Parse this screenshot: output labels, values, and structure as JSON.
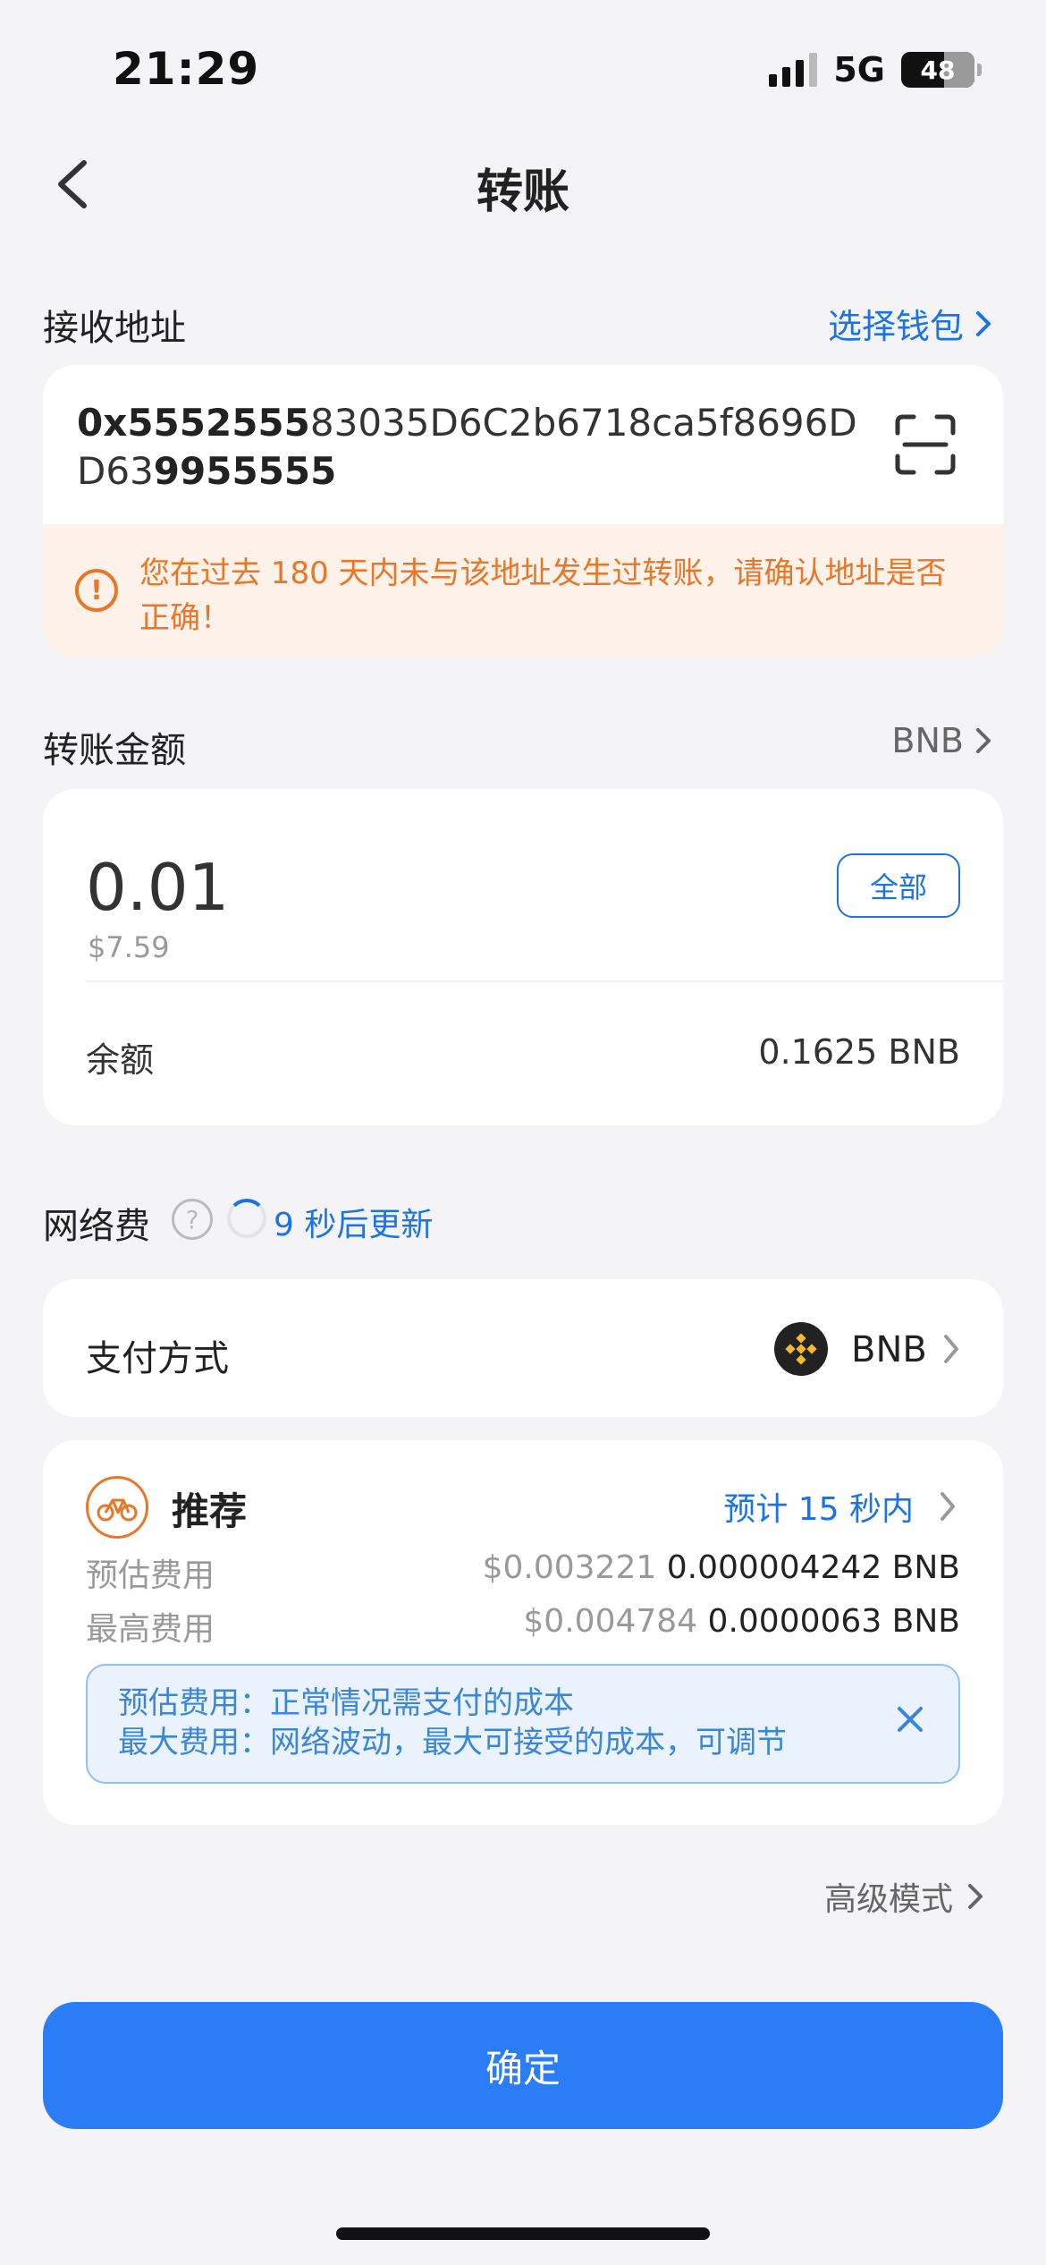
{
  "status_bar": {
    "time": "21:29",
    "network": "5G",
    "battery": "48"
  },
  "header": {
    "title": "转账"
  },
  "receive": {
    "label": "接收地址",
    "select_wallet": "选择钱包",
    "address_bold_prefix": "0x5552555",
    "address_middle": "83035D6C2b6718ca5f8696DD63",
    "address_bold_suffix": "9955555"
  },
  "warning": {
    "text": "您在过去 180 天内未与该地址发生过转账，请确认地址是否正确！"
  },
  "amount_section": {
    "label": "转账金额",
    "token": "BNB",
    "amount": "0.01",
    "usd_value": "$7.59",
    "all_button": "全部",
    "balance_label": "余额",
    "balance_value": "0.1625 BNB"
  },
  "network_fee": {
    "label": "网络费",
    "refresh_text": "9 秒后更新"
  },
  "payment": {
    "label": "支付方式",
    "token": "BNB"
  },
  "fee_detail": {
    "tier": "推荐",
    "eta": "预计 15 秒内",
    "estimated_label": "预估费用",
    "estimated_usd": "$0.003221",
    "estimated_bnb": "0.000004242 BNB",
    "max_label": "最高费用",
    "max_usd": "$0.004784",
    "max_bnb": "0.0000063 BNB",
    "info_line1": "预估费用：正常情况需支付的成本",
    "info_line2": "最大费用：网络波动，最大可接受的成本，可调节"
  },
  "advanced": "高级模式",
  "confirm_button": "确定",
  "colors": {
    "accent": "#1a73e8",
    "warning": "#e8772a",
    "button": "#2a7df4",
    "bnb": "#f3ba2f"
  }
}
